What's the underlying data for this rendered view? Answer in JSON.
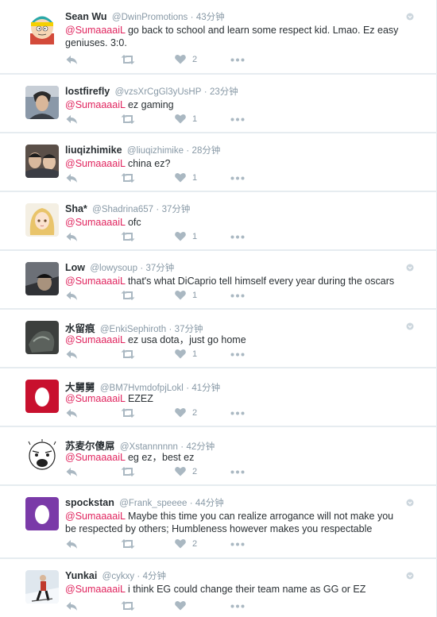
{
  "tweets": [
    {
      "name": "Sean Wu",
      "handle": "@DwinPromotions",
      "sep": "·",
      "time": "43分钟",
      "mention": "@SumaaaaiL",
      "text": " go back to school and learn some respect kid. Lmao. Ez easy geniuses. 3:0.",
      "likes": "2",
      "avatar": "cartoon"
    },
    {
      "name": "lostfirefly",
      "handle": "@vzsXrCgGl3yUsHP",
      "sep": "·",
      "time": "23分钟",
      "mention": "@SumaaaaiL",
      "text": " ez gaming",
      "likes": "1",
      "avatar": "photo"
    },
    {
      "name": "liuqizhimike",
      "handle": "@liuqizhimike",
      "sep": "·",
      "time": "28分钟",
      "mention": "@SumaaaaiL",
      "text": " china ez?",
      "likes": "1",
      "avatar": "photo"
    },
    {
      "name": "Sha*",
      "handle": "@Shadrina657",
      "sep": "·",
      "time": "37分钟",
      "mention": "@SumaaaaiL",
      "text": " ofc",
      "likes": "1",
      "avatar": "anime"
    },
    {
      "name": "Low",
      "handle": "@lowysoup",
      "sep": "·",
      "time": "37分钟",
      "mention": "@SumaaaaiL",
      "text": " that's what DiCaprio tell himself every year during the oscars",
      "likes": "1",
      "avatar": "dark"
    },
    {
      "name": "水留痕",
      "handle": "@EnkiSephiroth",
      "sep": "·",
      "time": "37分钟",
      "mention": "@SumaaaaiL",
      "text": " ez usa dota，just go home",
      "likes": "1",
      "avatar": "dark"
    },
    {
      "name": "大舅舅",
      "handle": "@BM7HvmdofpjLokl",
      "sep": "·",
      "time": "41分钟",
      "mention": "@SumaaaaiL",
      "text": " EZEZ",
      "likes": "2",
      "avatar": "egg-red"
    },
    {
      "name": "苏麦尔傻屌",
      "handle": "@Xstannnnnn",
      "sep": "·",
      "time": "42分钟",
      "mention": "@SumaaaaiL",
      "text": " eg ez，best ez",
      "likes": "2",
      "avatar": "meme"
    },
    {
      "name": "spockstan",
      "handle": "@Frank_speeee",
      "sep": "·",
      "time": "44分钟",
      "mention": "@SumaaaaiL",
      "text": "  Maybe this time you can realize arrogance will not make you be respected by others; Humbleness however makes you respectable",
      "likes": "2",
      "avatar": "egg-purple"
    },
    {
      "name": "Yunkai",
      "handle": "@cykxy",
      "sep": "·",
      "time": "4分钟",
      "mention": "@SumaaaaiL",
      "text": "  i think EG could change their team name as GG or EZ",
      "likes": "",
      "avatar": "ski"
    }
  ]
}
